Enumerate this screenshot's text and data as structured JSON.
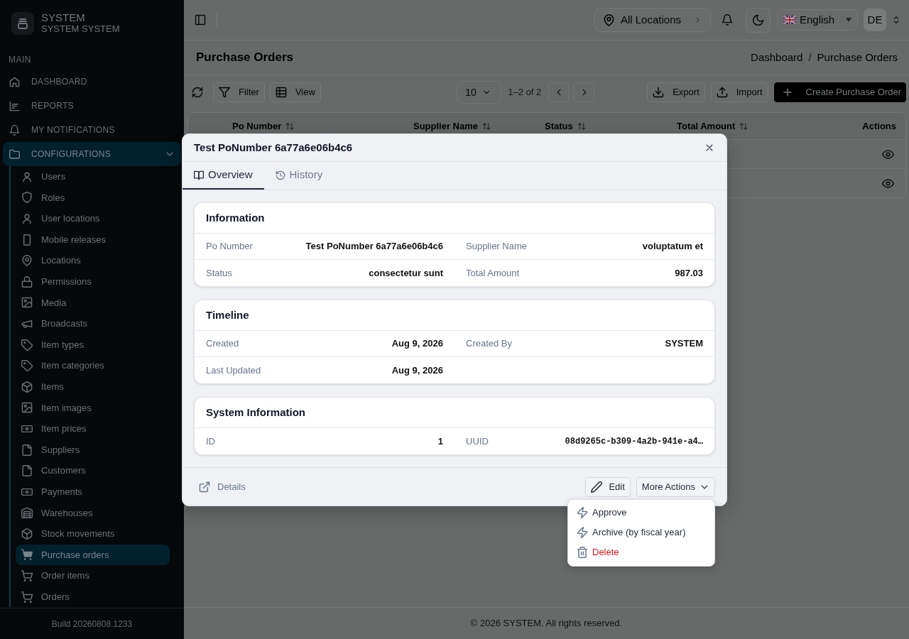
{
  "sidebar": {
    "brand": {
      "title": "SYSTEM",
      "subtitle": "SYSTEM SYSTEM"
    },
    "section": "MAIN",
    "items": [
      {
        "label": "DASHBOARD",
        "selected": false
      },
      {
        "label": "REPORTS",
        "selected": false
      },
      {
        "label": "MY NOTIFICATIONS",
        "selected": false
      },
      {
        "label": "CONFIGURATIONS",
        "selected": true,
        "expanded": true,
        "children": [
          {
            "label": "Users",
            "selected": false
          },
          {
            "label": "Roles",
            "selected": false
          },
          {
            "label": "User locations",
            "selected": false
          },
          {
            "label": "Mobile releases",
            "selected": false
          },
          {
            "label": "Locations",
            "selected": false
          },
          {
            "label": "Permissions",
            "selected": false
          },
          {
            "label": "Media",
            "selected": false
          },
          {
            "label": "Broadcasts",
            "selected": false
          },
          {
            "label": "Item types",
            "selected": false
          },
          {
            "label": "Item categories",
            "selected": false
          },
          {
            "label": "Items",
            "selected": false
          },
          {
            "label": "Item images",
            "selected": false
          },
          {
            "label": "Item prices",
            "selected": false
          },
          {
            "label": "Suppliers",
            "selected": false
          },
          {
            "label": "Customers",
            "selected": false
          },
          {
            "label": "Payments",
            "selected": false
          },
          {
            "label": "Warehouses",
            "selected": false
          },
          {
            "label": "Stock movements",
            "selected": false
          },
          {
            "label": "Purchase orders",
            "selected": true
          },
          {
            "label": "Order items",
            "selected": false
          },
          {
            "label": "Orders",
            "selected": false
          }
        ]
      }
    ],
    "build": "Build 20260808.1233"
  },
  "topbar": {
    "location": "All Locations",
    "language": "English",
    "avatar": "DE"
  },
  "page": {
    "title": "Purchase Orders",
    "breadcrumb": [
      "Dashboard",
      "Purchase Orders"
    ],
    "breadcrumb_separator": "/"
  },
  "toolbar": {
    "left_buttons": [
      "Filter",
      "View"
    ],
    "page_size": "10",
    "range": "1–2 of 2",
    "right_buttons": [
      {
        "label": "Export",
        "kind": "outline"
      },
      {
        "label": "Import",
        "kind": "outline"
      },
      {
        "label": "Create Purchase Order",
        "kind": "primary"
      }
    ]
  },
  "table": {
    "columns": [
      {
        "label": "Po Number",
        "sortable": true
      },
      {
        "label": "Supplier Name",
        "sortable": true
      },
      {
        "label": "Status",
        "sortable": true
      },
      {
        "label": "Total Amount",
        "sortable": true
      },
      {
        "label": "Actions",
        "sortable": false
      }
    ],
    "rows": [
      {
        "viewable": true
      },
      {
        "viewable": true
      }
    ]
  },
  "modal": {
    "title": "Test PoNumber 6a77a6e06b4c6",
    "tabs": [
      {
        "label": "Overview",
        "selected": true
      },
      {
        "label": "History",
        "selected": false
      }
    ],
    "sections": [
      {
        "title": "Information",
        "fields": [
          {
            "label": "Po Number",
            "value": "Test PoNumber 6a77a6e06b4c6",
            "kind": "text"
          },
          {
            "label": "Supplier Name",
            "value": "voluptatum et",
            "kind": "text"
          },
          {
            "label": "Status",
            "value": "consectetur sunt",
            "kind": "text"
          },
          {
            "label": "Total Amount",
            "value": "987.03",
            "kind": "text"
          }
        ]
      },
      {
        "title": "Timeline",
        "fields": [
          {
            "label": "Created",
            "value": "Aug 9, 2026",
            "kind": "text"
          },
          {
            "label": "Created By",
            "value": "SYSTEM",
            "kind": "text"
          },
          {
            "label": "Last Updated",
            "value": "Aug 9, 2026",
            "kind": "text"
          }
        ]
      },
      {
        "title": "System Information",
        "fields": [
          {
            "label": "ID",
            "value": "1",
            "kind": "text"
          },
          {
            "label": "UUID",
            "value": "08d9265c-b309-4a2b-941e-a4…",
            "kind": "code"
          }
        ]
      }
    ],
    "footer_link": "Details",
    "buttons": [
      {
        "label": "Edit",
        "kind": "edit"
      },
      {
        "label": "More Actions",
        "kind": "dropdown",
        "expanded": true,
        "menu": [
          {
            "label": "Approve",
            "kind": "action"
          },
          {
            "label": "Archive (by fiscal year)",
            "kind": "action"
          },
          {
            "label": "Delete",
            "kind": "danger"
          }
        ]
      }
    ]
  },
  "footer": {
    "text": "© 2026 SYSTEM. All rights reserved."
  }
}
